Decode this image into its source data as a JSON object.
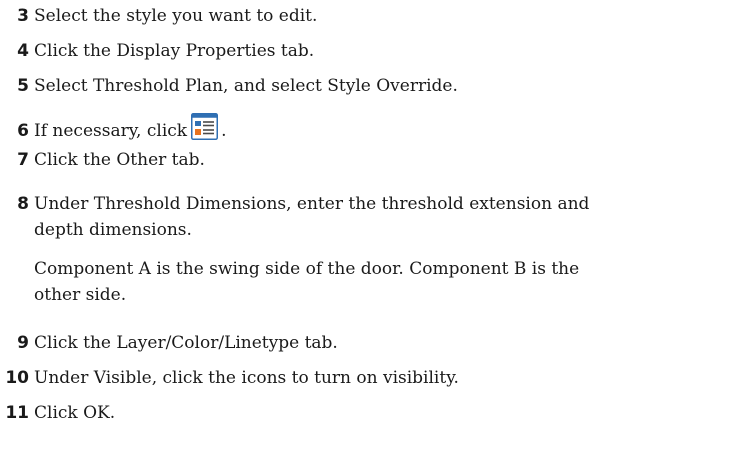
{
  "steps": [
    {
      "num": "3",
      "text": "Select the style you want to edit."
    },
    {
      "num": "4",
      "text": "Click the Display Properties tab."
    },
    {
      "num": "5",
      "text": "Select Threshold Plan, and select Style Override."
    },
    {
      "num": "6",
      "text_before": "If necessary, click",
      "text_after": ".",
      "icon": "display-properties-icon"
    },
    {
      "num": "7",
      "text": "Click the Other tab."
    },
    {
      "num": "8",
      "line1": "Under Threshold Dimensions, enter the threshold extension and",
      "line2": "depth dimensions.",
      "note_line1": "Component A is the swing side of the door. Component B is the",
      "note_line2": "other side."
    },
    {
      "num": "9",
      "text": "Click the Layer/Color/Linetype tab."
    },
    {
      "num": "10",
      "text": "Under Visible, click the icons to turn on visibility."
    },
    {
      "num": "11",
      "text": "Click OK."
    }
  ],
  "colors": {
    "icon_border": "#2f6fb3",
    "icon_fill": "#ffffff",
    "icon_blue": "#2f6fb3",
    "icon_orange": "#e8731e",
    "icon_line": "#4a4a4a"
  }
}
